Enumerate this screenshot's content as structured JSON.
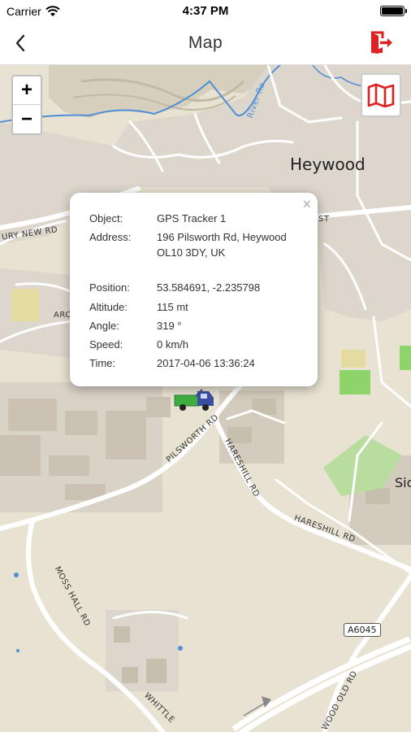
{
  "status_bar": {
    "carrier": "Carrier",
    "time": "4:37 PM"
  },
  "nav": {
    "title": "Map"
  },
  "map": {
    "zoom_in": "+",
    "zoom_out": "−",
    "place": "Heywood",
    "labels": {
      "river": "River Ro",
      "bury_new_rd": "URY NEW RD",
      "arc": "ARC",
      "st": "ST",
      "pilsworth_rd": "PILSWORTH RD",
      "hareshill_rd_1": "HARESHILL RD",
      "hareshill_rd_2": "HARESHILL RD",
      "moss_hall_rd": "MOSS HALL RD",
      "whittle": "WHITTLE",
      "wood_old_rd": "WOOD OLD RD",
      "sic": "Sic",
      "a6045": "A6045"
    }
  },
  "popup": {
    "close": "×",
    "rows": [
      {
        "label": "Object:",
        "value": "GPS Tracker 1"
      },
      {
        "label": "Address:",
        "value": "196 Pilsworth Rd, Heywood OL10 3DY, UK"
      },
      {
        "label": "Position:",
        "value": "53.584691, -2.235798"
      },
      {
        "label": "Altitude:",
        "value": "115 mt"
      },
      {
        "label": "Angle:",
        "value": "319 °"
      },
      {
        "label": "Speed:",
        "value": "0 km/h"
      },
      {
        "label": "Time:",
        "value": "2017-04-06 13:36:24"
      }
    ]
  },
  "colors": {
    "accent": "#e02020",
    "map_bg": "#e8e2d3",
    "water": "#4f8fd6",
    "green": "#8fd36b",
    "vehicle_cab": "#3a4fa0",
    "vehicle_bed": "#3fae3f"
  }
}
